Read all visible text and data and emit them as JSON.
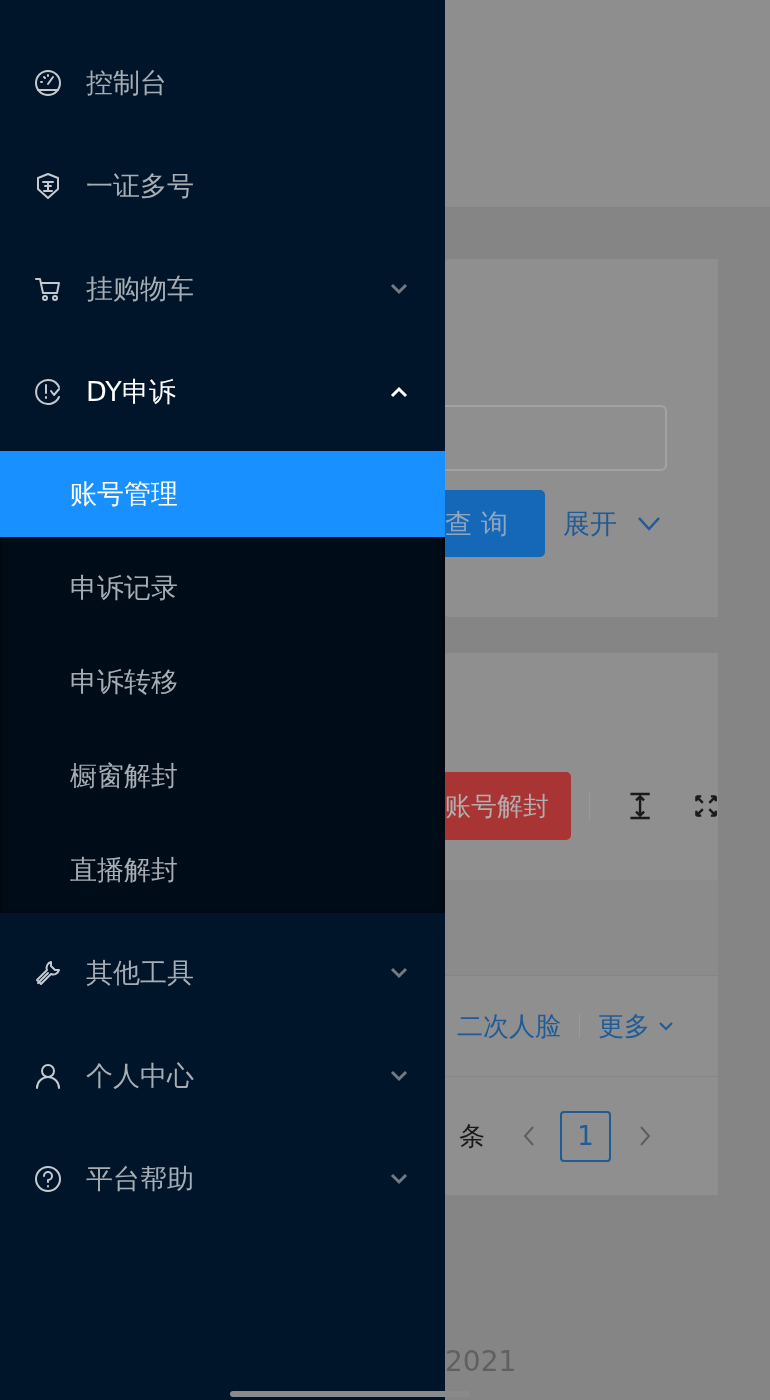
{
  "sidebar": {
    "items": [
      {
        "label": "控制台",
        "kind": "link"
      },
      {
        "label": "一证多号",
        "kind": "link"
      },
      {
        "label": "挂购物车",
        "kind": "submenu",
        "expanded": false
      },
      {
        "label": "DY申诉",
        "kind": "submenu",
        "expanded": true,
        "children": [
          {
            "label": "账号管理",
            "selected": true
          },
          {
            "label": "申诉记录",
            "selected": false
          },
          {
            "label": "申诉转移",
            "selected": false
          },
          {
            "label": "橱窗解封",
            "selected": false
          },
          {
            "label": "直播解封",
            "selected": false
          }
        ]
      },
      {
        "label": "其他工具",
        "kind": "submenu",
        "expanded": false
      },
      {
        "label": "个人中心",
        "kind": "submenu",
        "expanded": false
      },
      {
        "label": "平台帮助",
        "kind": "submenu",
        "expanded": false
      }
    ]
  },
  "search": {
    "query_button": "查 询",
    "expand_link": "展开"
  },
  "toolbar": {
    "unseal_button": "账号解封"
  },
  "table": {
    "row_actions": [
      "二次人脸",
      "更多"
    ]
  },
  "pagination": {
    "total_suffix": "条",
    "pages": [
      {
        "label": "1",
        "selected": true
      }
    ]
  },
  "footer": {
    "text": "2021"
  }
}
